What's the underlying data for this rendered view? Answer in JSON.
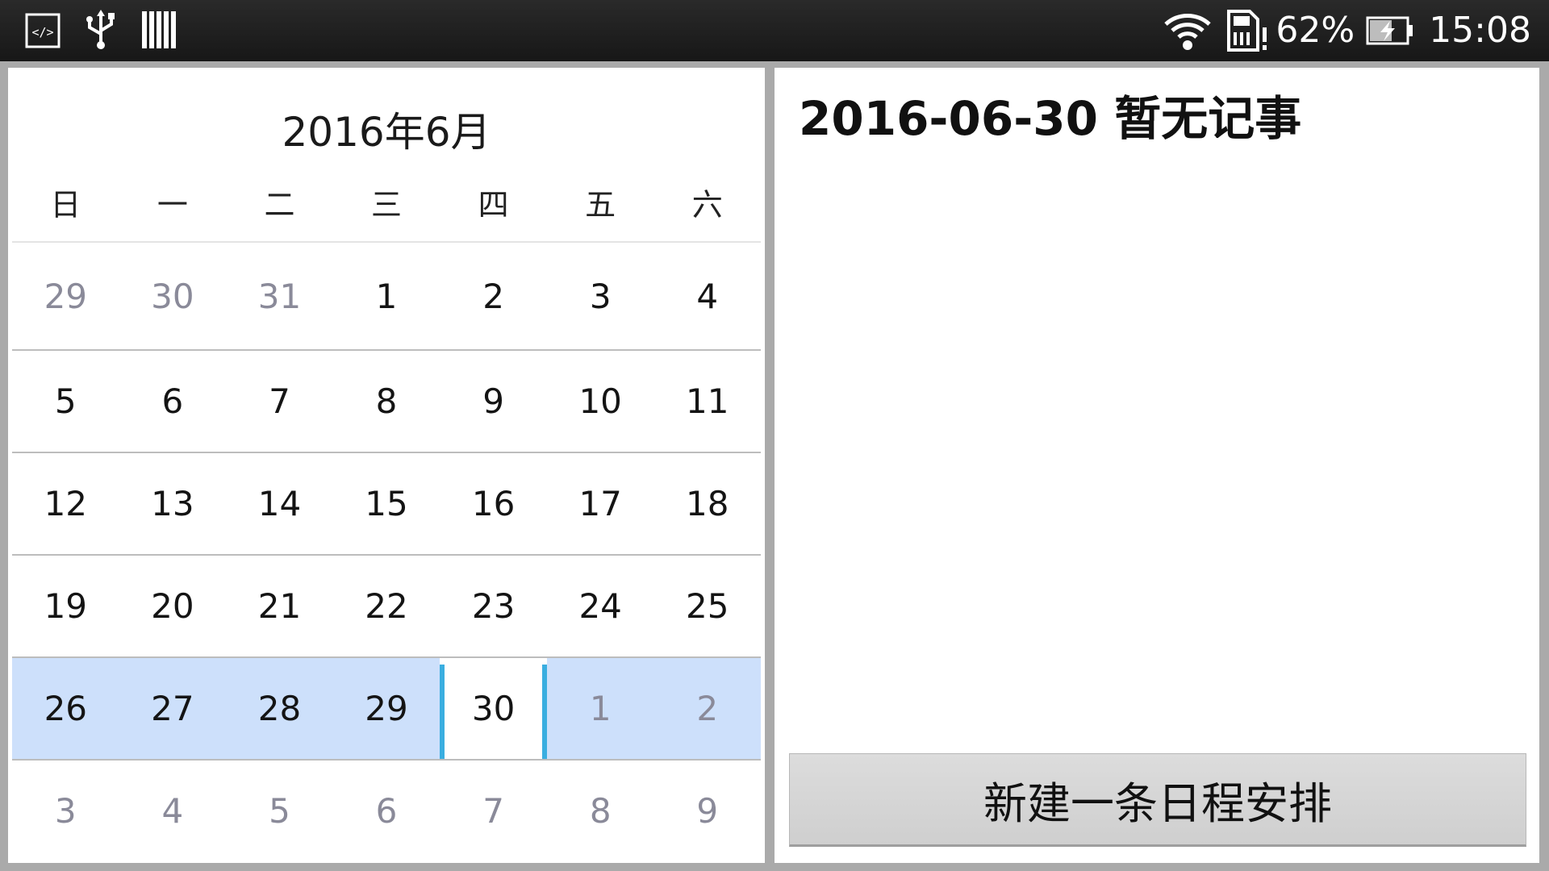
{
  "status_bar": {
    "icons_left": [
      "developer-icon",
      "usb-icon",
      "storage-bars-icon"
    ],
    "icons_right": [
      "wifi-icon",
      "sim-card-icon",
      "battery-charging-icon"
    ],
    "battery_percent": "62%",
    "battery_level": 0.62,
    "time": "15:08"
  },
  "calendar": {
    "month_title": "2016年6月",
    "weekdays": [
      "日",
      "一",
      "二",
      "三",
      "四",
      "五",
      "六"
    ],
    "weeks": [
      [
        {
          "d": "29",
          "other": true
        },
        {
          "d": "30",
          "other": true
        },
        {
          "d": "31",
          "other": true
        },
        {
          "d": "1"
        },
        {
          "d": "2"
        },
        {
          "d": "3"
        },
        {
          "d": "4"
        }
      ],
      [
        {
          "d": "5"
        },
        {
          "d": "6"
        },
        {
          "d": "7"
        },
        {
          "d": "8"
        },
        {
          "d": "9"
        },
        {
          "d": "10"
        },
        {
          "d": "11"
        }
      ],
      [
        {
          "d": "12"
        },
        {
          "d": "13"
        },
        {
          "d": "14"
        },
        {
          "d": "15"
        },
        {
          "d": "16"
        },
        {
          "d": "17"
        },
        {
          "d": "18"
        }
      ],
      [
        {
          "d": "19"
        },
        {
          "d": "20"
        },
        {
          "d": "21"
        },
        {
          "d": "22"
        },
        {
          "d": "23"
        },
        {
          "d": "24"
        },
        {
          "d": "25"
        }
      ],
      [
        {
          "d": "26"
        },
        {
          "d": "27"
        },
        {
          "d": "28"
        },
        {
          "d": "29"
        },
        {
          "d": "30",
          "today": true
        },
        {
          "d": "1",
          "other": true
        },
        {
          "d": "2",
          "other": true
        }
      ],
      [
        {
          "d": "3",
          "other": true
        },
        {
          "d": "4",
          "other": true
        },
        {
          "d": "5",
          "other": true
        },
        {
          "d": "6",
          "other": true
        },
        {
          "d": "7",
          "other": true
        },
        {
          "d": "8",
          "other": true
        },
        {
          "d": "9",
          "other": true
        }
      ]
    ],
    "selected_week_index": 4,
    "colors": {
      "selected_week": "#cde0fb",
      "today_marker": "#3aaee0",
      "other_month_text": "#8a8a99"
    }
  },
  "detail": {
    "date_heading": "2016-06-30 暂无记事",
    "new_button_label": "新建一条日程安排"
  }
}
